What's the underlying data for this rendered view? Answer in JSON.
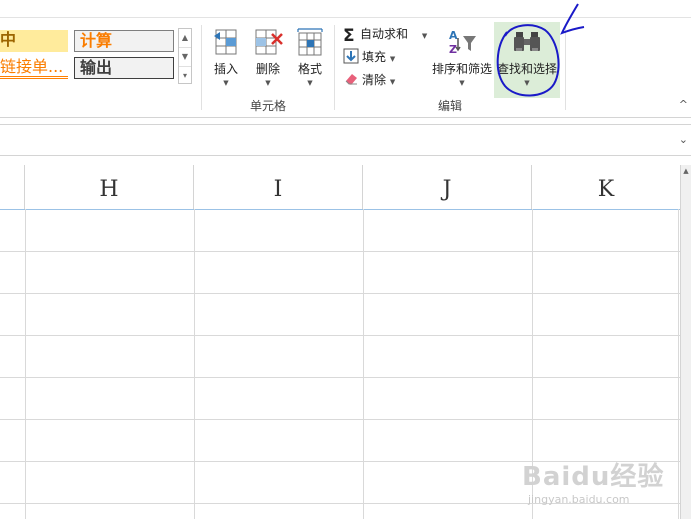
{
  "ribbon": {
    "cell_styles": {
      "neutral_label": "中",
      "calculation_label": "计算",
      "linked_cell_label": "链接单...",
      "output_label": "输出"
    },
    "cells_group": {
      "label": "单元格",
      "insert_label": "插入",
      "delete_label": "删除",
      "format_label": "格式"
    },
    "editing_group": {
      "label": "编辑",
      "autosum_label": "自动求和",
      "fill_label": "填充",
      "clear_label": "清除",
      "sort_filter_label": "排序和筛选",
      "find_select_label": "查找和选择"
    },
    "colors": {
      "find_select_highlight": "#dcedd8",
      "annotation_ink": "#1a1ac8"
    }
  },
  "sheet": {
    "columns": [
      "H",
      "I",
      "J",
      "K"
    ]
  },
  "watermark": {
    "brand": "Baidu经验",
    "url": "jingyan.baidu.com"
  }
}
